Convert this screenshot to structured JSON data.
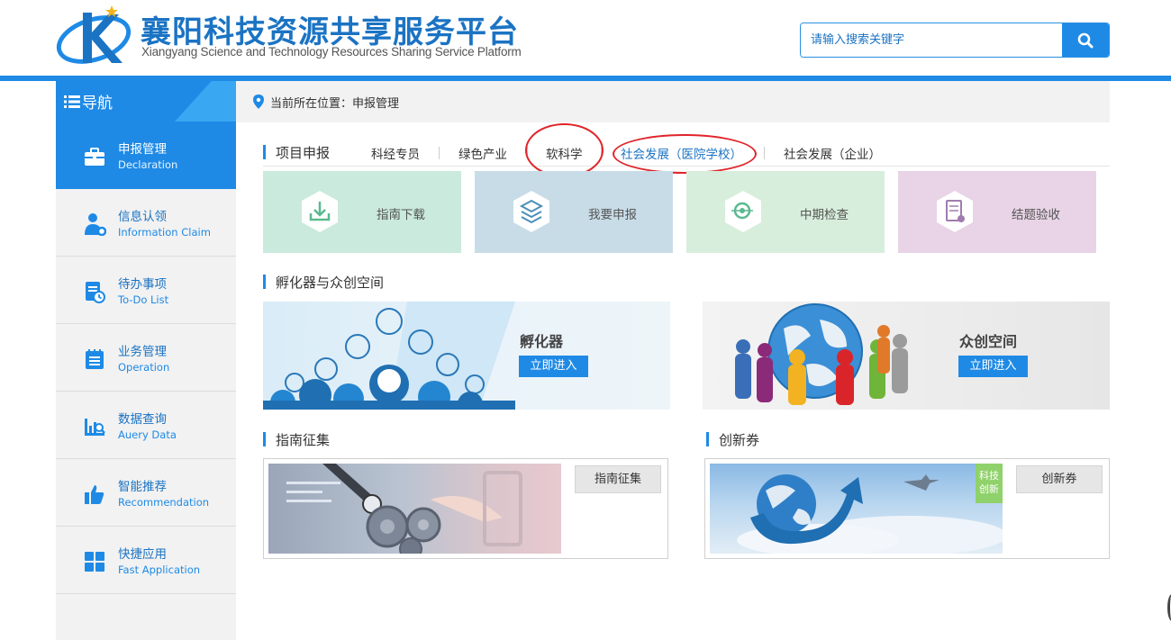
{
  "header": {
    "title_cn": "襄阳科技资源共享服务平台",
    "title_en": "Xiangyang Science and Technology Resources Sharing Service Platform",
    "search_placeholder": "请输入搜索关键字"
  },
  "sidebar": {
    "title": "导航",
    "items": [
      {
        "cn": "申报管理",
        "en": "Declaration",
        "icon": "briefcase-icon",
        "active": true
      },
      {
        "cn": "信息认领",
        "en": "Information Claim",
        "icon": "user-gear-icon",
        "active": false
      },
      {
        "cn": "待办事项",
        "en": "To-Do List",
        "icon": "todo-clock-icon",
        "active": false
      },
      {
        "cn": "业务管理",
        "en": "Operation",
        "icon": "notepad-icon",
        "active": false
      },
      {
        "cn": "数据查询",
        "en": "Auery Data",
        "icon": "chart-search-icon",
        "active": false
      },
      {
        "cn": "智能推荐",
        "en": "Recommendation",
        "icon": "thumbs-up-icon",
        "active": false
      },
      {
        "cn": "快捷应用",
        "en": "Fast Application",
        "icon": "grid-icon",
        "active": false
      }
    ]
  },
  "breadcrumb": {
    "text": "当前所在位置：申报管理"
  },
  "project": {
    "heading": "项目申报",
    "tabs": [
      "科经专员",
      "绿色产业",
      "软科学",
      "社会发展（医院学校）",
      "社会发展（企业）"
    ],
    "cards": [
      {
        "label": "指南下载",
        "icon": "download-icon",
        "color": "#c9eadc"
      },
      {
        "label": "我要申报",
        "icon": "layers-icon",
        "color": "#c8dce7"
      },
      {
        "label": "中期检查",
        "icon": "search-target-icon",
        "color": "#d8eedc"
      },
      {
        "label": "结题验收",
        "icon": "document-check-icon",
        "color": "#e8d4e6"
      }
    ]
  },
  "incubator": {
    "heading": "孵化器与众创空间",
    "banners": [
      {
        "title": "孵化器",
        "button": "立即进入"
      },
      {
        "title": "众创空间",
        "button": "立即进入"
      }
    ]
  },
  "guide": {
    "heading": "指南征集",
    "button": "指南征集"
  },
  "voucher": {
    "heading": "创新券",
    "button": "创新券",
    "tag_line1": "科技",
    "tag_line2": "创新"
  },
  "colors": {
    "accent": "#1e8ae6",
    "annotation": "#e0242a"
  }
}
